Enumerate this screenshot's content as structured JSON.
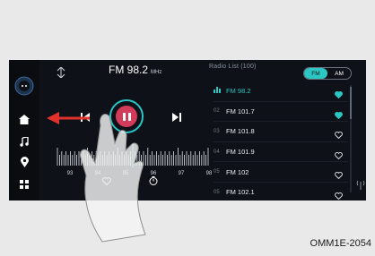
{
  "header": {
    "frequency": "FM 98.2",
    "unit": "MHz"
  },
  "list": {
    "title": "Radio List (100)",
    "bands": [
      "FM",
      "AM"
    ],
    "active_band": "FM",
    "items": [
      {
        "num": "",
        "name": "FM 98.2",
        "active": true,
        "favorite": true
      },
      {
        "num": "02",
        "name": "FM 101.7",
        "active": false,
        "favorite": true
      },
      {
        "num": "03",
        "name": "FM 101.8",
        "active": false,
        "favorite": false
      },
      {
        "num": "04",
        "name": "FM 101.9",
        "active": false,
        "favorite": false
      },
      {
        "num": "05",
        "name": "FM 102",
        "active": false,
        "favorite": false
      },
      {
        "num": "05",
        "name": "FM 102.1",
        "active": false,
        "favorite": false
      }
    ]
  },
  "tuner": {
    "ticks": [
      "93",
      "94",
      "95",
      "96",
      "97",
      "98"
    ]
  },
  "colors": {
    "accent": "#2cc7c3",
    "play": "#d33b5a",
    "arrow": "#e0322a"
  },
  "caption": "OMM1E-2054"
}
